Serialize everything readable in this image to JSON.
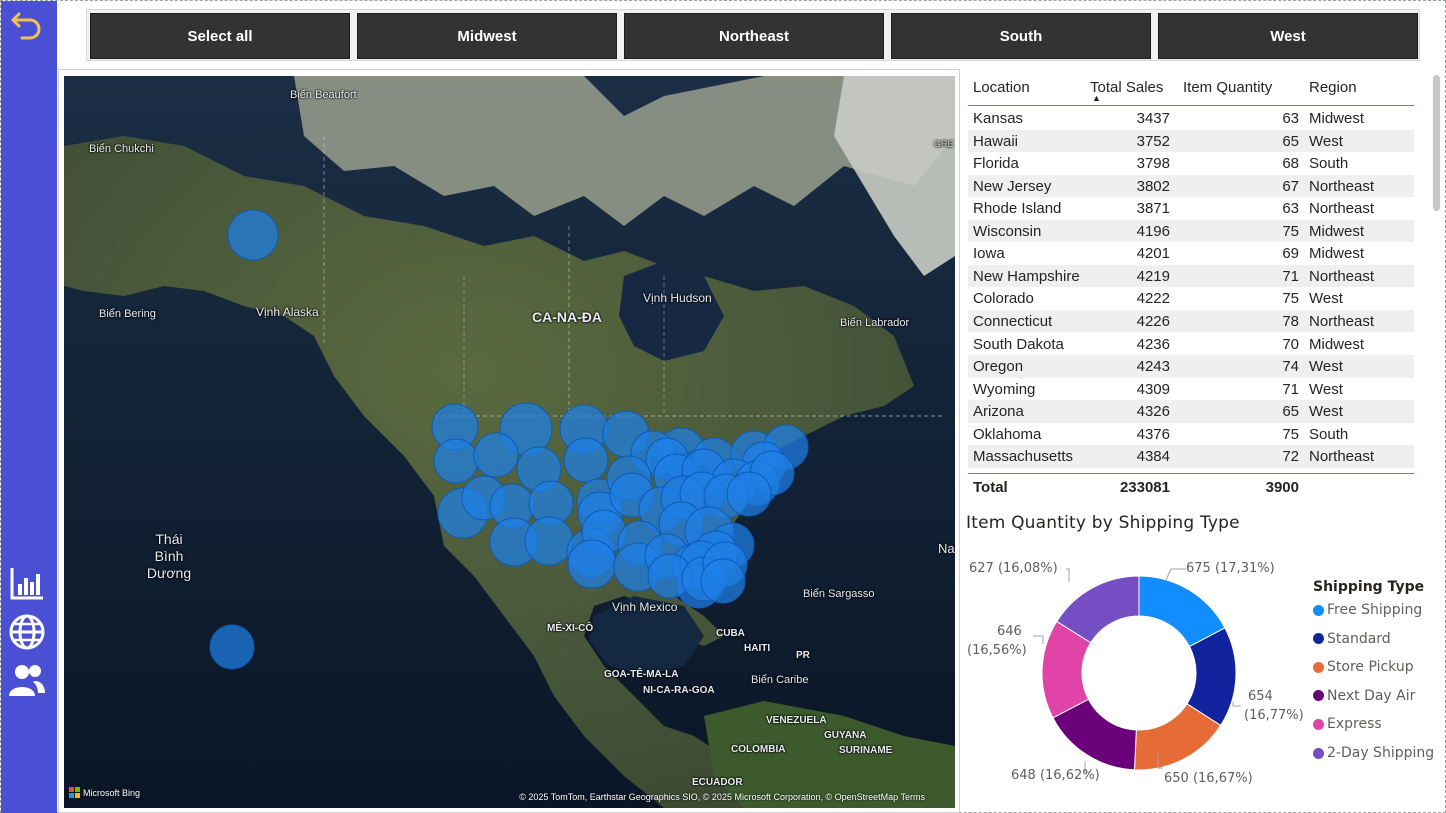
{
  "sidebar": {
    "back_icon": "undo-arrow-icon",
    "nav_icons": [
      "bar-chart-icon",
      "globe-icon",
      "users-icon"
    ]
  },
  "filters": {
    "buttons": [
      "Select all",
      "Midwest",
      "Northeast",
      "South",
      "West"
    ]
  },
  "map": {
    "labels": {
      "beaufort": "Biển Beaufort",
      "chukchi": "Biển Chukchi",
      "bering": "Biển Bering",
      "alaska_gulf": "Vịnh Alaska",
      "canada": "CA-NA-ĐA",
      "hudson": "Vịnh Hudson",
      "labrador": "Biển Labrador",
      "pacific": "Thái\nBình\nDương",
      "sargasso": "Biển Sargasso",
      "mexico_gulf": "Vịnh Mexico",
      "mexico": "MÊ-XI-CÔ",
      "cuba": "CUBA",
      "haiti": "HAITI",
      "pr": "PR",
      "guatemala": "GOA-TÊ-MA-LA",
      "nicaragua": "NI-CA-RA-GOA",
      "caribbean": "Biển Caribe",
      "venezuela": "VENEZUELA",
      "guyana": "GUYANA",
      "colombia": "COLOMBIA",
      "suriname": "SURINAME",
      "ecuador": "ECUADOR",
      "greenland_partial": "GRE",
      "atlantic_partial": "Na"
    },
    "attribution": "© 2025 TomTom, Earthstar Geographics SIO, © 2025 Microsoft Corporation, © OpenStreetMap  Terms",
    "bing_logo": "Microsoft Bing",
    "bubble_color": "#1e7fe6"
  },
  "table": {
    "columns": [
      "Location",
      "Total Sales",
      "Item Quantity",
      "Region"
    ],
    "sort_indicator": "▲",
    "rows": [
      {
        "location": "Kansas",
        "sales": "3437",
        "qty": "63",
        "region": "Midwest"
      },
      {
        "location": "Hawaii",
        "sales": "3752",
        "qty": "65",
        "region": "West"
      },
      {
        "location": "Florida",
        "sales": "3798",
        "qty": "68",
        "region": "South"
      },
      {
        "location": "New Jersey",
        "sales": "3802",
        "qty": "67",
        "region": "Northeast"
      },
      {
        "location": "Rhode Island",
        "sales": "3871",
        "qty": "63",
        "region": "Northeast"
      },
      {
        "location": "Wisconsin",
        "sales": "4196",
        "qty": "75",
        "region": "Midwest"
      },
      {
        "location": "Iowa",
        "sales": "4201",
        "qty": "69",
        "region": "Midwest"
      },
      {
        "location": "New Hampshire",
        "sales": "4219",
        "qty": "71",
        "region": "Northeast"
      },
      {
        "location": "Colorado",
        "sales": "4222",
        "qty": "75",
        "region": "West"
      },
      {
        "location": "Connecticut",
        "sales": "4226",
        "qty": "78",
        "region": "Northeast"
      },
      {
        "location": "South Dakota",
        "sales": "4236",
        "qty": "70",
        "region": "Midwest"
      },
      {
        "location": "Oregon",
        "sales": "4243",
        "qty": "74",
        "region": "West"
      },
      {
        "location": "Wyoming",
        "sales": "4309",
        "qty": "71",
        "region": "West"
      },
      {
        "location": "Arizona",
        "sales": "4326",
        "qty": "65",
        "region": "West"
      },
      {
        "location": "Oklahoma",
        "sales": "4376",
        "qty": "75",
        "region": "South"
      },
      {
        "location": "Massachusetts",
        "sales": "4384",
        "qty": "72",
        "region": "Northeast"
      }
    ],
    "total": {
      "label": "Total",
      "sales": "233081",
      "qty": "3900"
    }
  },
  "chart_data": {
    "type": "pie",
    "title": "Item Quantity by Shipping Type",
    "legend_title": "Shipping Type",
    "legend_position": "right",
    "slices": [
      {
        "name": "Free Shipping",
        "value": 675,
        "label": "675 (17,31%)",
        "color": "#118dff"
      },
      {
        "name": "Standard",
        "value": 654,
        "label": "654 (16,77%)",
        "color": "#12239e"
      },
      {
        "name": "Store Pickup",
        "value": 650,
        "label": "650 (16,67%)",
        "color": "#e66c37"
      },
      {
        "name": "Next Day Air",
        "value": 648,
        "label": "648 (16,62%)",
        "color": "#6b007b"
      },
      {
        "name": "Express",
        "value": 646,
        "label": "646 (16,56%)",
        "color": "#e044a7"
      },
      {
        "name": "2-Day Shipping",
        "value": 627,
        "label": "627 (16,08%)",
        "color": "#744ec2"
      }
    ],
    "donut_label_646_lines": [
      "646",
      "(16,56%)"
    ],
    "donut_label_654_lines": [
      "654",
      "(16,77%)"
    ]
  }
}
